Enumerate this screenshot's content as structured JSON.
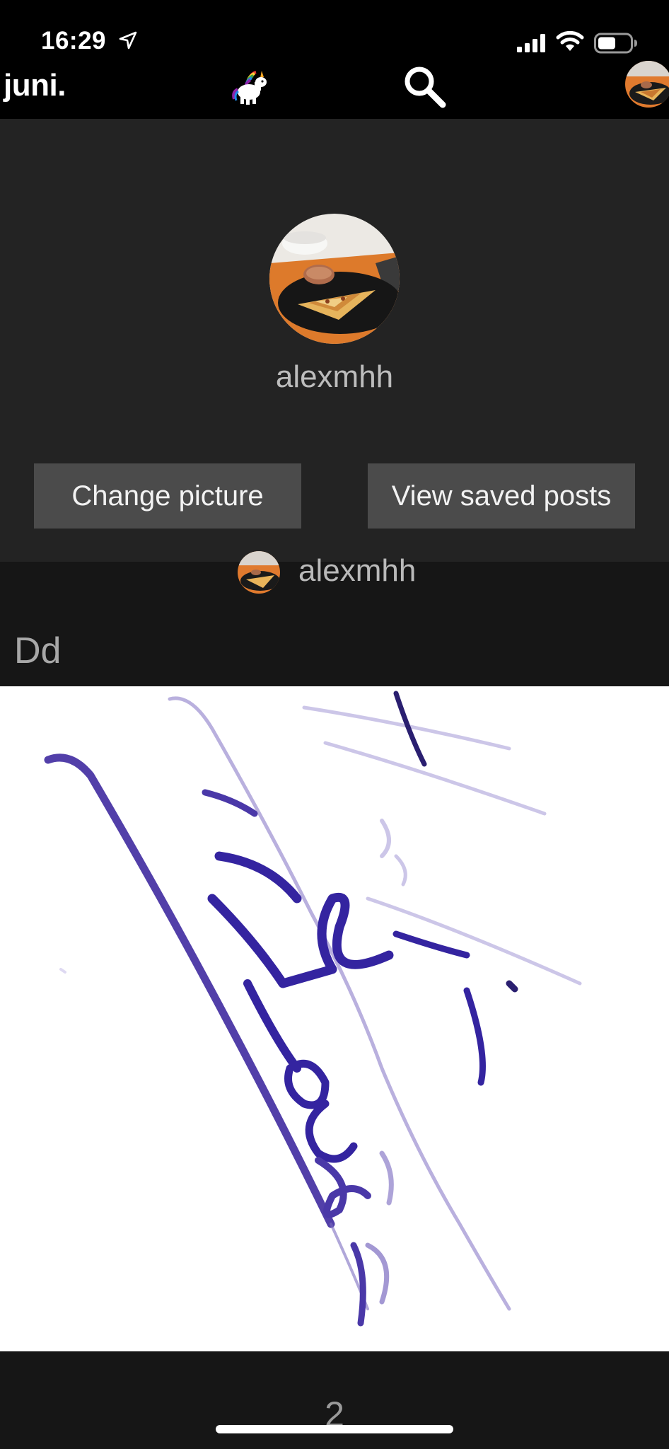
{
  "status_bar": {
    "time": "16:29",
    "icons": [
      "location-arrow-icon",
      "cellular-signal-icon",
      "wifi-icon",
      "battery-icon"
    ]
  },
  "app_bar": {
    "logo": "juni.",
    "icons": [
      "unicorn-icon",
      "search-icon",
      "profile-avatar-icon"
    ]
  },
  "profile": {
    "username": "alexmhh",
    "change_picture_label": "Change picture",
    "view_saved_label": "View saved posts"
  },
  "post": {
    "author": "alexmhh",
    "title": "Dd",
    "likes": "2"
  },
  "colors": {
    "background": "#000000",
    "header_bg": "#232323",
    "post_bg": "#161616",
    "button_bg": "#4b4b4b",
    "muted_text": "#bdbdbd",
    "ink": "#3f2aa0"
  }
}
